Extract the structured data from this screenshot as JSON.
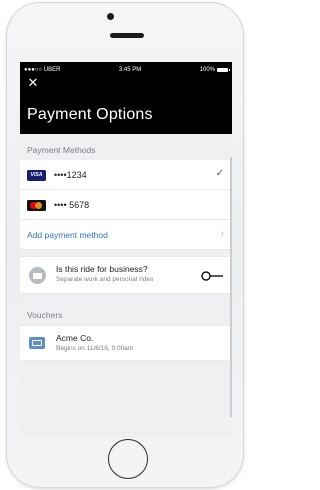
{
  "status_bar": {
    "carrier": "●●●○○ UBER",
    "time": "3:45 PM",
    "battery": "100%"
  },
  "header": {
    "close_icon": "close-icon",
    "title": "Payment Options"
  },
  "payment_methods": {
    "section_label": "Payment Methods",
    "cards": [
      {
        "brand": "VISA",
        "number": "••••1234",
        "selected": true
      },
      {
        "brand": "mastercard",
        "number": "•••• 5678",
        "selected": false
      }
    ],
    "add_label": "Add payment method",
    "check_glyph": "✓",
    "chevron_glyph": "›"
  },
  "business": {
    "title": "Is this ride for business?",
    "subtitle": "Separate work and personal rides",
    "toggle_on": false
  },
  "vouchers": {
    "section_label": "Vouchers",
    "items": [
      {
        "title": "Acme Co.",
        "subtitle": "Begins on 11/6/18, 9:00am"
      }
    ]
  },
  "colors": {
    "link": "#2f6fc4",
    "header_bg": "#000000",
    "visa": "#1a1f71"
  }
}
